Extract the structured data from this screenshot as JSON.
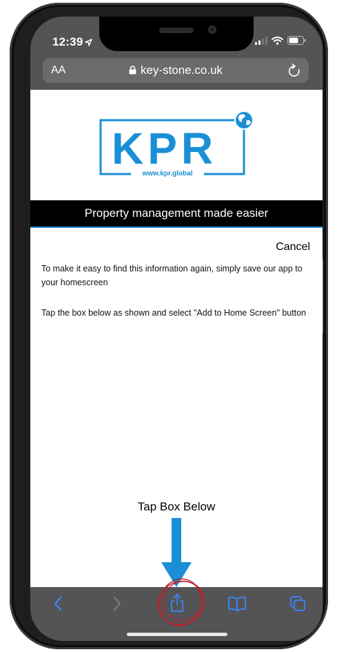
{
  "status": {
    "time": "12:39"
  },
  "browser": {
    "aa_label": "AA",
    "url": "key-stone.co.uk"
  },
  "page": {
    "logo_text": "KPR",
    "logo_url": "www.kpr.global",
    "tagline": "Property management made easier",
    "cancel_label": "Cancel",
    "message1": "To make it easy to find this information again, simply save our app to your homescreen",
    "message2": "Tap the box below as shown and select \"Add to Home Screen\" button",
    "tap_label": "Tap Box Below"
  },
  "toolbar": {
    "items": [
      "back-icon",
      "forward-icon",
      "share-icon",
      "bookmarks-icon",
      "tabs-icon"
    ]
  },
  "colors": {
    "accent": "#1a8fd6",
    "ios_blue": "#3a86ff",
    "annotation_red": "#c0202a",
    "chrome": "#545456"
  }
}
